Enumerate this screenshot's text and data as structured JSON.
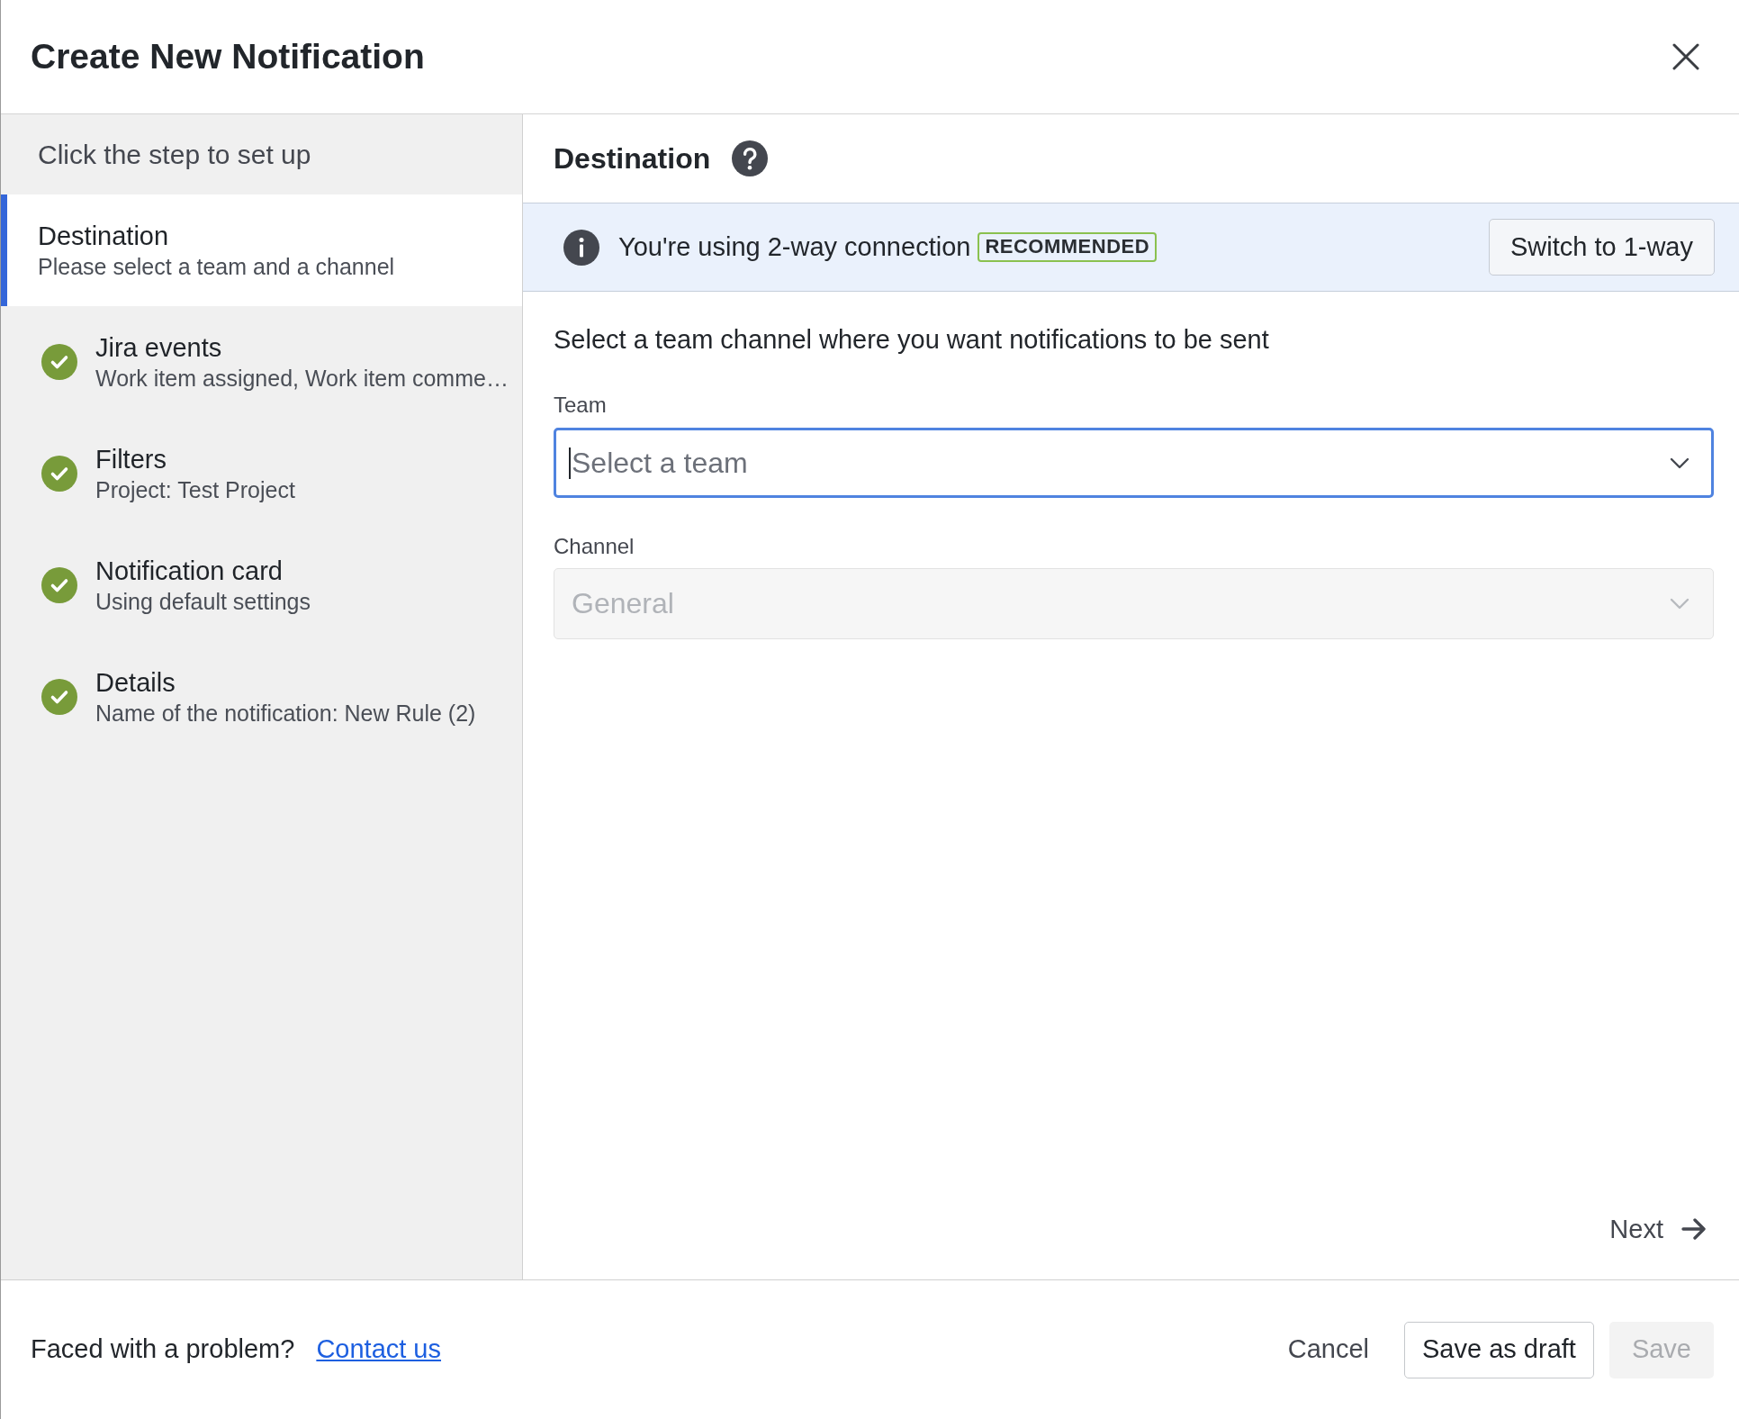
{
  "dialog": {
    "title": "Create New Notification"
  },
  "sidebar": {
    "heading": "Click the step to set up",
    "steps": [
      {
        "title": "Destination",
        "subtitle": "Please select a team and a channel",
        "selected": true,
        "completed": false
      },
      {
        "title": "Jira events",
        "subtitle": "Work item assigned, Work item comme…",
        "selected": false,
        "completed": true
      },
      {
        "title": "Filters",
        "subtitle": "Project: Test Project",
        "selected": false,
        "completed": true
      },
      {
        "title": "Notification card",
        "subtitle": "Using default settings",
        "selected": false,
        "completed": true
      },
      {
        "title": "Details",
        "subtitle": "Name of the notification: New Rule (2)",
        "selected": false,
        "completed": true
      }
    ]
  },
  "main": {
    "heading": "Destination",
    "banner": {
      "message": "You're using 2-way connection",
      "badge": "RECOMMENDED",
      "button": "Switch to 1-way"
    },
    "instruction": "Select a team channel where you want notifications to be sent",
    "fields": [
      {
        "label": "Team",
        "placeholder": "Select a team",
        "focused": true,
        "disabled": false
      },
      {
        "label": "Channel",
        "value": "General",
        "focused": false,
        "disabled": true
      }
    ],
    "next": "Next"
  },
  "footer": {
    "prompt": "Faced with a problem?",
    "link": "Contact us",
    "buttons": [
      {
        "label": "Cancel",
        "kind": "subtle",
        "disabled": false
      },
      {
        "label": "Save as draft",
        "kind": "default",
        "disabled": false
      },
      {
        "label": "Save",
        "kind": "primary",
        "disabled": true
      }
    ]
  }
}
